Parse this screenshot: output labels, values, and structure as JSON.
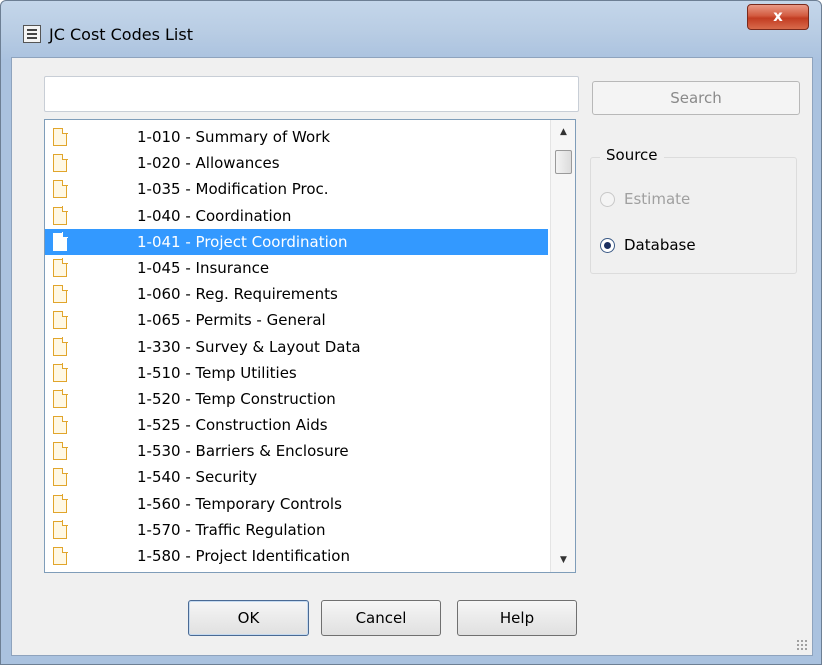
{
  "window": {
    "title": "JC Cost Codes List",
    "close_label": "x"
  },
  "search": {
    "value": "",
    "placeholder": "",
    "button_label": "Search"
  },
  "list": {
    "items": [
      {
        "label": "1-010 - Summary of Work",
        "selected": false
      },
      {
        "label": "1-020 - Allowances",
        "selected": false
      },
      {
        "label": "1-035 - Modification Proc.",
        "selected": false
      },
      {
        "label": "1-040 - Coordination",
        "selected": false
      },
      {
        "label": "1-041 - Project Coordination",
        "selected": true
      },
      {
        "label": "1-045 - Insurance",
        "selected": false
      },
      {
        "label": "1-060 - Reg. Requirements",
        "selected": false
      },
      {
        "label": "1-065 - Permits - General",
        "selected": false
      },
      {
        "label": "1-330 - Survey & Layout Data",
        "selected": false
      },
      {
        "label": "1-510 - Temp Utilities",
        "selected": false
      },
      {
        "label": "1-520 - Temp Construction",
        "selected": false
      },
      {
        "label": "1-525 - Construction Aids",
        "selected": false
      },
      {
        "label": "1-530 - Barriers & Enclosure",
        "selected": false
      },
      {
        "label": "1-540 - Security",
        "selected": false
      },
      {
        "label": "1-560 - Temporary Controls",
        "selected": false
      },
      {
        "label": "1-570 - Traffic Regulation",
        "selected": false
      },
      {
        "label": "1-580 - Project Identification",
        "selected": false
      }
    ]
  },
  "source": {
    "legend": "Source",
    "options": [
      {
        "label": "Estimate",
        "checked": false,
        "disabled": true
      },
      {
        "label": "Database",
        "checked": true,
        "disabled": false
      }
    ]
  },
  "buttons": {
    "ok": "OK",
    "cancel": "Cancel",
    "help": "Help"
  },
  "colors": {
    "selection": "#3399ff",
    "close_button": "#c23c22"
  }
}
